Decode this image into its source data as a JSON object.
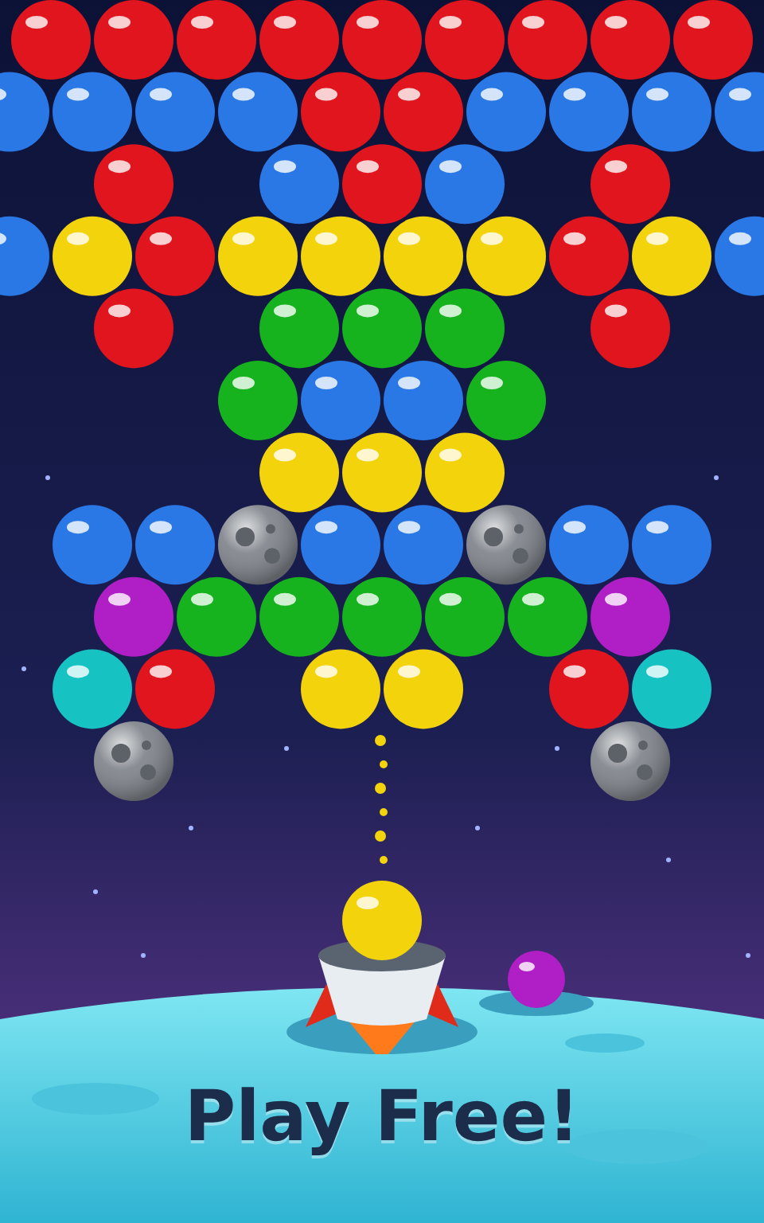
{
  "bubble_rows": [
    {
      "cells": [
        {
          "kind": "bubble",
          "color": "#e0151d"
        },
        {
          "kind": "bubble",
          "color": "#e0151d"
        },
        {
          "kind": "bubble",
          "color": "#e0151d"
        },
        {
          "kind": "bubble",
          "color": "#e0151d"
        },
        {
          "kind": "bubble",
          "color": "#e0151d"
        },
        {
          "kind": "bubble",
          "color": "#e0151d"
        },
        {
          "kind": "bubble",
          "color": "#e0151d"
        },
        {
          "kind": "bubble",
          "color": "#e0151d"
        },
        {
          "kind": "bubble",
          "color": "#e0151d"
        }
      ]
    },
    {
      "cells": [
        {
          "kind": "bubble",
          "color": "#2a78e6"
        },
        {
          "kind": "bubble",
          "color": "#2a78e6"
        },
        {
          "kind": "bubble",
          "color": "#2a78e6"
        },
        {
          "kind": "bubble",
          "color": "#2a78e6"
        },
        {
          "kind": "bubble",
          "color": "#e0151d"
        },
        {
          "kind": "bubble",
          "color": "#e0151d"
        },
        {
          "kind": "bubble",
          "color": "#2a78e6"
        },
        {
          "kind": "bubble",
          "color": "#2a78e6"
        },
        {
          "kind": "bubble",
          "color": "#2a78e6"
        },
        {
          "kind": "bubble",
          "color": "#2a78e6"
        }
      ]
    },
    {
      "cells": [
        {
          "kind": "empty"
        },
        {
          "kind": "bubble",
          "color": "#e0151d"
        },
        {
          "kind": "empty"
        },
        {
          "kind": "bubble",
          "color": "#2a78e6"
        },
        {
          "kind": "bubble",
          "color": "#e0151d"
        },
        {
          "kind": "bubble",
          "color": "#2a78e6"
        },
        {
          "kind": "empty"
        },
        {
          "kind": "bubble",
          "color": "#e0151d"
        },
        {
          "kind": "empty"
        }
      ]
    },
    {
      "cells": [
        {
          "kind": "bubble",
          "color": "#2a78e6"
        },
        {
          "kind": "bubble",
          "color": "#f2d30c"
        },
        {
          "kind": "bubble",
          "color": "#e0151d"
        },
        {
          "kind": "bubble",
          "color": "#f2d30c"
        },
        {
          "kind": "bubble",
          "color": "#f2d30c"
        },
        {
          "kind": "bubble",
          "color": "#f2d30c"
        },
        {
          "kind": "bubble",
          "color": "#f2d30c"
        },
        {
          "kind": "bubble",
          "color": "#e0151d"
        },
        {
          "kind": "bubble",
          "color": "#f2d30c"
        },
        {
          "kind": "bubble",
          "color": "#2a78e6"
        }
      ]
    },
    {
      "cells": [
        {
          "kind": "empty"
        },
        {
          "kind": "bubble",
          "color": "#e0151d"
        },
        {
          "kind": "empty"
        },
        {
          "kind": "bubble",
          "color": "#16b31e"
        },
        {
          "kind": "bubble",
          "color": "#16b31e"
        },
        {
          "kind": "bubble",
          "color": "#16b31e"
        },
        {
          "kind": "empty"
        },
        {
          "kind": "bubble",
          "color": "#e0151d"
        },
        {
          "kind": "empty"
        }
      ]
    },
    {
      "cells": [
        {
          "kind": "empty"
        },
        {
          "kind": "empty"
        },
        {
          "kind": "empty"
        },
        {
          "kind": "bubble",
          "color": "#16b31e"
        },
        {
          "kind": "bubble",
          "color": "#2a78e6"
        },
        {
          "kind": "bubble",
          "color": "#2a78e6"
        },
        {
          "kind": "bubble",
          "color": "#16b31e"
        },
        {
          "kind": "empty"
        },
        {
          "kind": "empty"
        },
        {
          "kind": "empty"
        }
      ]
    },
    {
      "cells": [
        {
          "kind": "empty"
        },
        {
          "kind": "empty"
        },
        {
          "kind": "empty"
        },
        {
          "kind": "bubble",
          "color": "#f2d30c"
        },
        {
          "kind": "bubble",
          "color": "#f2d30c"
        },
        {
          "kind": "bubble",
          "color": "#f2d30c"
        },
        {
          "kind": "empty"
        },
        {
          "kind": "empty"
        },
        {
          "kind": "empty"
        }
      ]
    },
    {
      "cells": [
        {
          "kind": "empty"
        },
        {
          "kind": "bubble",
          "color": "#2a78e6"
        },
        {
          "kind": "bubble",
          "color": "#2a78e6"
        },
        {
          "kind": "rock"
        },
        {
          "kind": "bubble",
          "color": "#2a78e6"
        },
        {
          "kind": "bubble",
          "color": "#2a78e6"
        },
        {
          "kind": "rock"
        },
        {
          "kind": "bubble",
          "color": "#2a78e6"
        },
        {
          "kind": "bubble",
          "color": "#2a78e6"
        },
        {
          "kind": "empty"
        }
      ]
    },
    {
      "cells": [
        {
          "kind": "empty"
        },
        {
          "kind": "bubble",
          "color": "#b01ec6"
        },
        {
          "kind": "bubble",
          "color": "#16b31e"
        },
        {
          "kind": "bubble",
          "color": "#16b31e"
        },
        {
          "kind": "bubble",
          "color": "#16b31e"
        },
        {
          "kind": "bubble",
          "color": "#16b31e"
        },
        {
          "kind": "bubble",
          "color": "#16b31e"
        },
        {
          "kind": "bubble",
          "color": "#b01ec6"
        },
        {
          "kind": "empty"
        }
      ]
    },
    {
      "cells": [
        {
          "kind": "empty"
        },
        {
          "kind": "bubble",
          "color": "#17c2c2"
        },
        {
          "kind": "bubble",
          "color": "#e0151d"
        },
        {
          "kind": "empty"
        },
        {
          "kind": "bubble",
          "color": "#f2d30c"
        },
        {
          "kind": "bubble",
          "color": "#f2d30c"
        },
        {
          "kind": "empty"
        },
        {
          "kind": "bubble",
          "color": "#e0151d"
        },
        {
          "kind": "bubble",
          "color": "#17c2c2"
        },
        {
          "kind": "empty"
        }
      ]
    },
    {
      "cells": [
        {
          "kind": "empty"
        },
        {
          "kind": "rock"
        },
        {
          "kind": "empty"
        },
        {
          "kind": "empty"
        },
        {
          "kind": "empty"
        },
        {
          "kind": "empty"
        },
        {
          "kind": "empty"
        },
        {
          "kind": "rock"
        },
        {
          "kind": "empty"
        }
      ]
    }
  ],
  "shooter": {
    "loaded": {
      "color": "#f2d30c"
    },
    "next": {
      "color": "#b01ec6"
    }
  },
  "caption": "Play Free!"
}
